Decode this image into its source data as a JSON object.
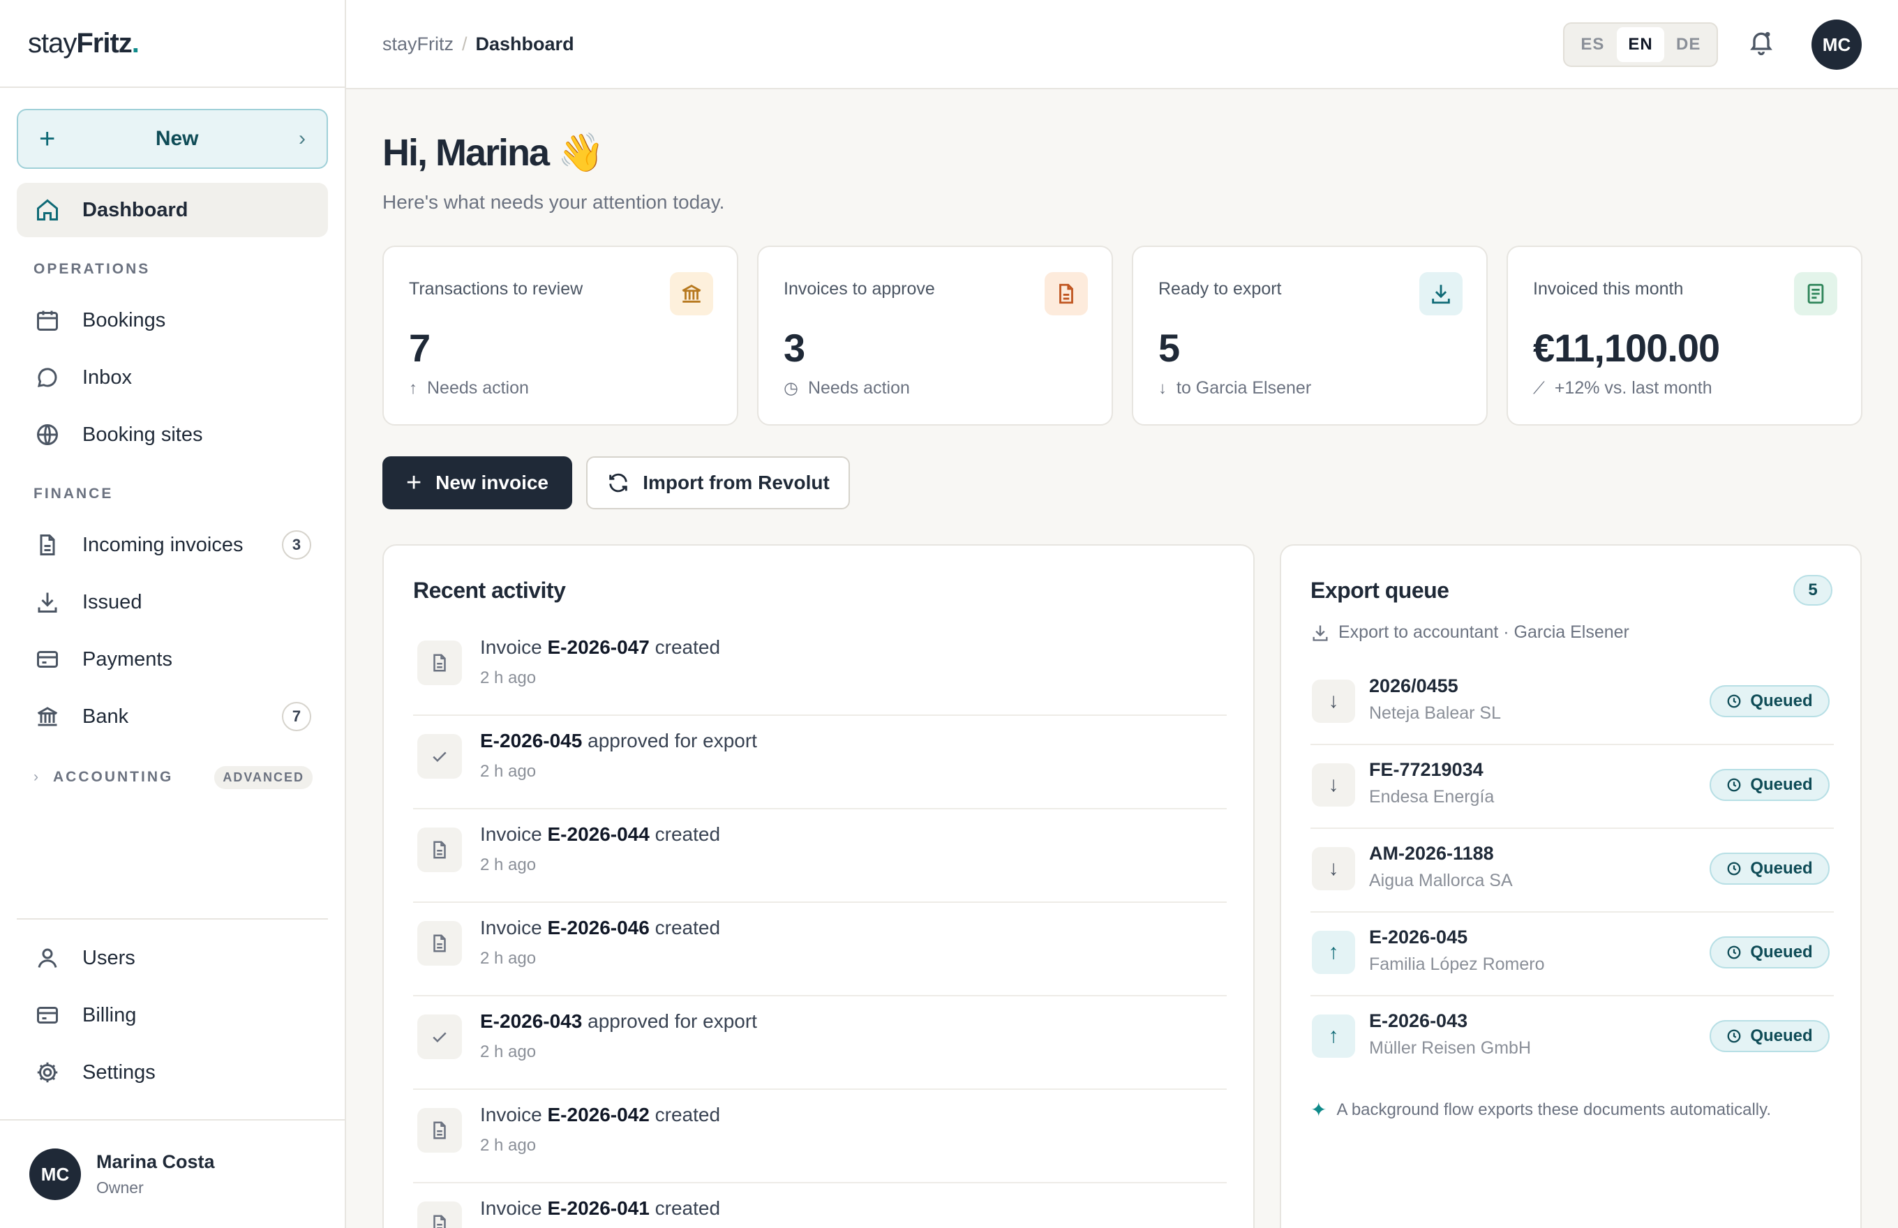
{
  "brand": {
    "name_a": "stay",
    "name_b": "Fritz",
    "dot": "."
  },
  "sidebar": {
    "new_label": "New",
    "dashboard": "Dashboard",
    "operations_label": "OPERATIONS",
    "operations": [
      "Bookings",
      "Inbox",
      "Booking sites"
    ],
    "finance_label": "FINANCE",
    "finance": [
      {
        "label": "Incoming invoices",
        "count": "3"
      },
      {
        "label": "Issued",
        "count": ""
      },
      {
        "label": "Payments",
        "count": ""
      },
      {
        "label": "Bank",
        "count": "7"
      }
    ],
    "accounting_label": "ACCOUNTING",
    "advanced_label": "ADVANCED",
    "bottom": [
      "Users",
      "Billing",
      "Settings"
    ],
    "user": {
      "initials": "MC",
      "name": "Marina Costa",
      "role": "Owner"
    }
  },
  "topbar": {
    "crumb_root": "stayFritz",
    "crumb_sep": "/",
    "crumb_current": "Dashboard",
    "languages": [
      "ES",
      "EN",
      "DE"
    ],
    "selected_language": "EN",
    "avatar_initials": "MC"
  },
  "greeting": {
    "title": "Hi, Marina 👋",
    "subtitle": "Here's what needs your attention today."
  },
  "stats": [
    {
      "label": "Transactions to review",
      "value": "7",
      "note": "Needs action",
      "note_icon": "↑",
      "icon": "bank-icon",
      "tile_bg": "#fdf0dc",
      "icon_color": "#b7791f"
    },
    {
      "label": "Invoices to approve",
      "value": "3",
      "note": "Needs action",
      "note_icon": "◷",
      "icon": "document-icon",
      "tile_bg": "#fdebdc",
      "icon_color": "#c05621"
    },
    {
      "label": "Ready to export",
      "value": "5",
      "note": "to Garcia Elsener",
      "note_icon": "↓",
      "icon": "download-icon",
      "tile_bg": "#e4f3f5",
      "icon_color": "#0f6a76"
    },
    {
      "label": "Invoiced this month",
      "value": "€11,100.00",
      "note": "+12% vs. last month",
      "note_icon": "⟋",
      "icon": "receipt-icon",
      "tile_bg": "#e3f4ea",
      "icon_color": "#2f855a"
    }
  ],
  "actions": {
    "new_invoice": "New invoice",
    "import": "Import from Revolut"
  },
  "activity": {
    "title": "Recent activity",
    "items": [
      {
        "type": "document",
        "prefix": "Invoice ",
        "ref": "E-2026-047",
        "suffix": " created",
        "time": "2 h ago"
      },
      {
        "type": "check",
        "prefix": "",
        "ref": "E-2026-045",
        "suffix": " approved for export",
        "time": "2 h ago"
      },
      {
        "type": "document",
        "prefix": "Invoice ",
        "ref": "E-2026-044",
        "suffix": " created",
        "time": "2 h ago"
      },
      {
        "type": "document",
        "prefix": "Invoice ",
        "ref": "E-2026-046",
        "suffix": " created",
        "time": "2 h ago"
      },
      {
        "type": "check",
        "prefix": "",
        "ref": "E-2026-043",
        "suffix": " approved for export",
        "time": "2 h ago"
      },
      {
        "type": "document",
        "prefix": "Invoice ",
        "ref": "E-2026-042",
        "suffix": " created",
        "time": "2 h ago"
      },
      {
        "type": "document",
        "prefix": "Invoice ",
        "ref": "E-2026-041",
        "suffix": " created",
        "time": ""
      }
    ]
  },
  "queue": {
    "title": "Export queue",
    "count": "5",
    "subtitle": "Export to accountant · Garcia Elsener",
    "items": [
      {
        "dir": "down",
        "number": "2026/0455",
        "party": "Neteja Balear SL",
        "status": "Queued"
      },
      {
        "dir": "down",
        "number": "FE-77219034",
        "party": "Endesa Energía",
        "status": "Queued"
      },
      {
        "dir": "down",
        "number": "AM-2026-1188",
        "party": "Aigua Mallorca SA",
        "status": "Queued"
      },
      {
        "dir": "up",
        "number": "E-2026-045",
        "party": "Familia López Romero",
        "status": "Queued"
      },
      {
        "dir": "up",
        "number": "E-2026-043",
        "party": "Müller Reisen GmbH",
        "status": "Queued"
      }
    ],
    "footer": "A background flow exports these documents automatically."
  }
}
